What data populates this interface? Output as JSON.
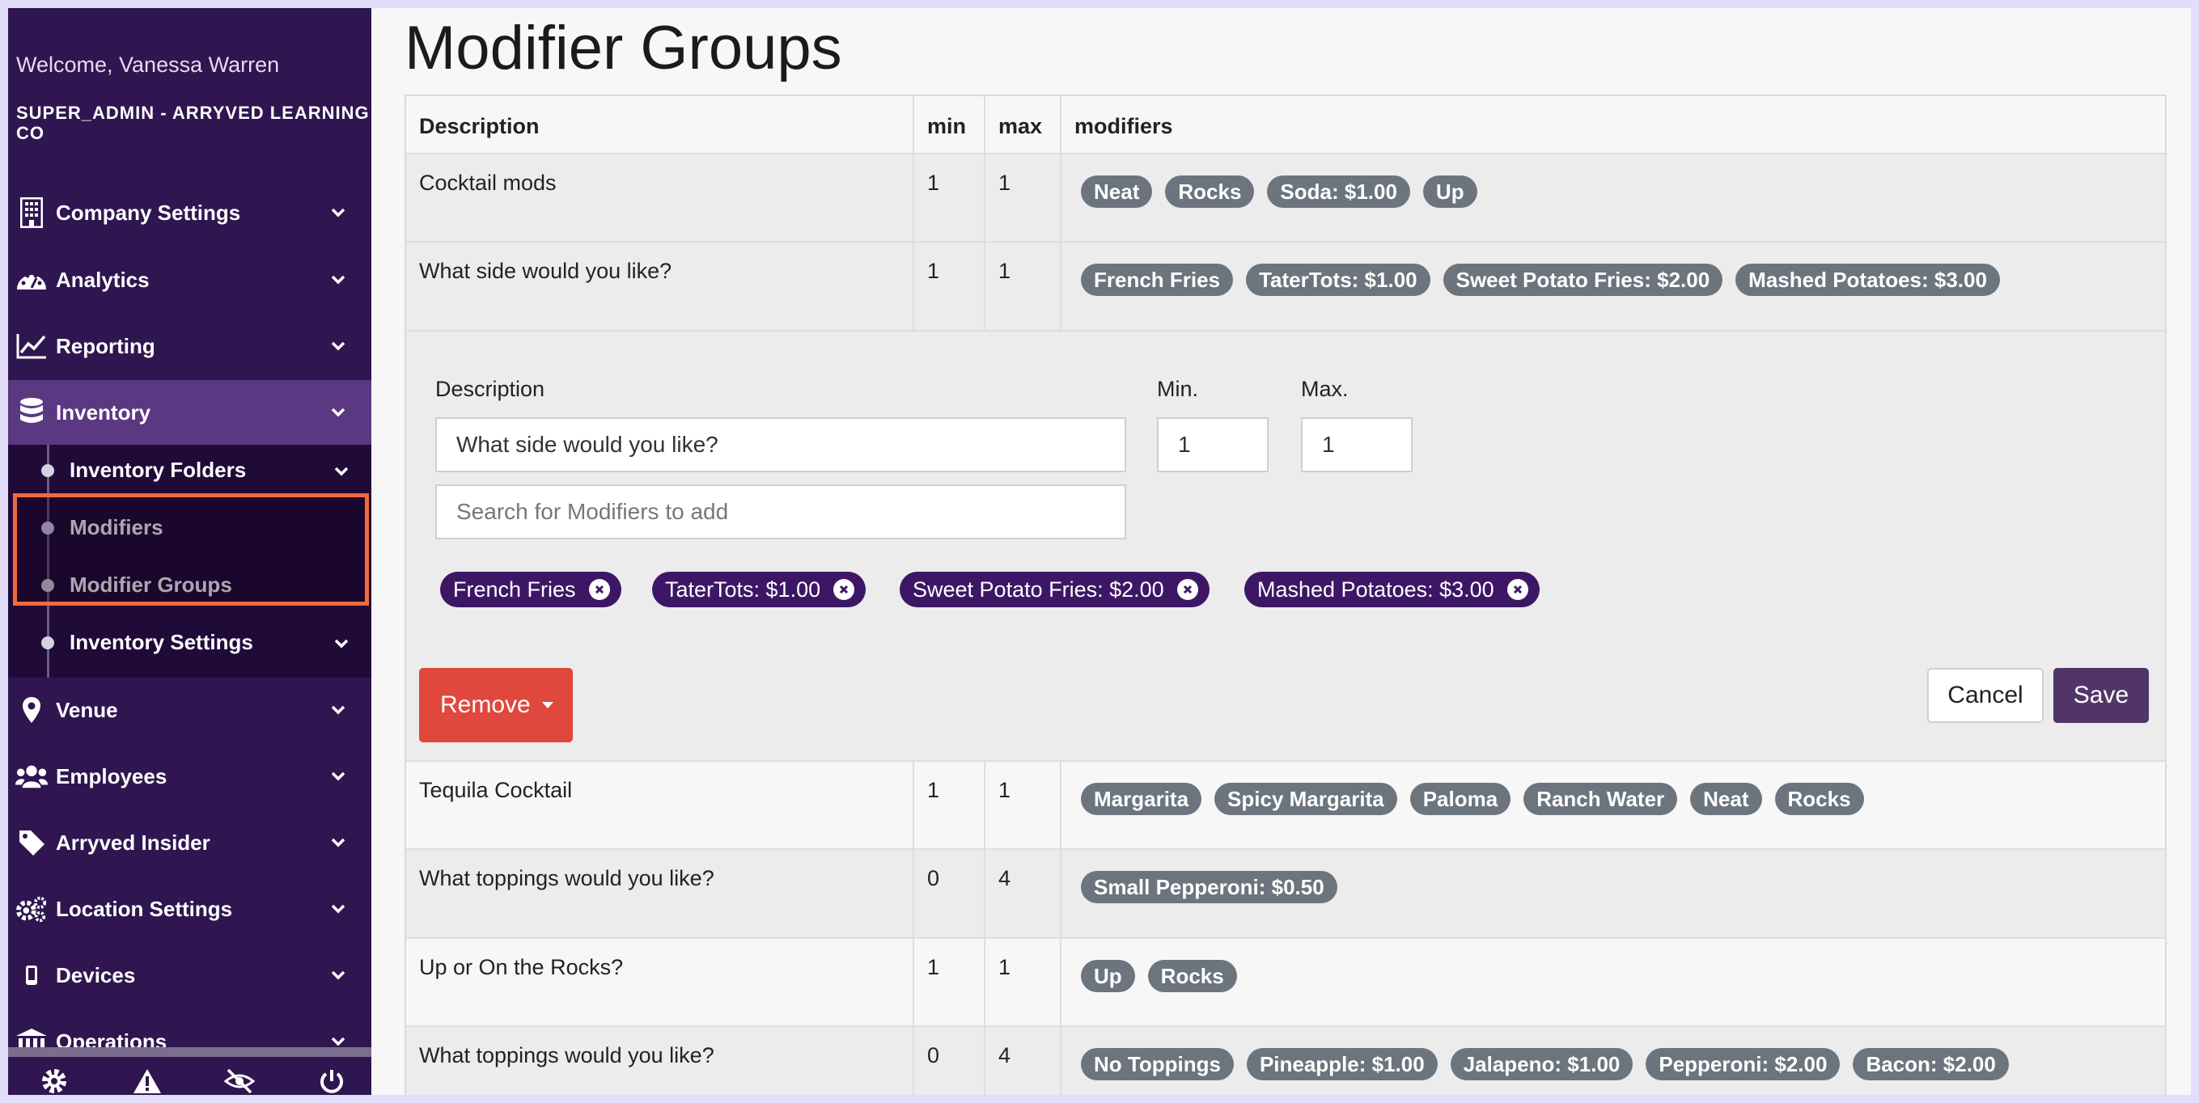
{
  "sidebar": {
    "welcome": "Welcome, Vanessa Warren",
    "role": "SUPER_ADMIN - ARRYVED LEARNING CO",
    "nav": [
      {
        "label": "Company Settings",
        "icon": "building-icon"
      },
      {
        "label": "Analytics",
        "icon": "palette-icon"
      },
      {
        "label": "Reporting",
        "icon": "line-chart-icon"
      },
      {
        "label": "Inventory",
        "icon": "database-icon"
      },
      {
        "label": "Venue",
        "icon": "map-pin-icon"
      },
      {
        "label": "Employees",
        "icon": "users-icon"
      },
      {
        "label": "Arryved Insider",
        "icon": "tag-icon"
      },
      {
        "label": "Location Settings",
        "icon": "cogs-icon"
      },
      {
        "label": "Devices",
        "icon": "mobile-icon"
      },
      {
        "label": "Operations",
        "icon": "bank-icon"
      }
    ],
    "inventory_sub": [
      {
        "label": "Inventory Folders"
      },
      {
        "label": "Modifiers"
      },
      {
        "label": "Modifier Groups"
      },
      {
        "label": "Inventory Settings"
      }
    ],
    "footer_icons": [
      "gear-icon",
      "warning-icon",
      "eye-slash-icon",
      "power-icon"
    ]
  },
  "page": {
    "title": "Modifier Groups"
  },
  "table": {
    "headers": {
      "description": "Description",
      "min": "min",
      "max": "max",
      "modifiers": "modifiers"
    },
    "rows_top": [
      {
        "description": "Cocktail mods",
        "min": "1",
        "max": "1",
        "modifiers": [
          "Neat",
          "Rocks",
          "Soda: $1.00",
          "Up"
        ]
      },
      {
        "description": "What side would you like?",
        "min": "1",
        "max": "1",
        "modifiers": [
          "French Fries",
          "TaterTots: $1.00",
          "Sweet Potato Fries: $2.00",
          "Mashed Potatoes: $3.00"
        ]
      }
    ],
    "rows_bottom": [
      {
        "description": "Tequila Cocktail",
        "min": "1",
        "max": "1",
        "modifiers": [
          "Margarita",
          "Spicy Margarita",
          "Paloma",
          "Ranch Water",
          "Neat",
          "Rocks"
        ]
      },
      {
        "description": "What toppings would you like?",
        "min": "0",
        "max": "4",
        "modifiers": [
          "Small Pepperoni: $0.50"
        ]
      },
      {
        "description": "Up or On the Rocks?",
        "min": "1",
        "max": "1",
        "modifiers": [
          "Up",
          "Rocks"
        ]
      },
      {
        "description": "What toppings would you like?",
        "min": "0",
        "max": "4",
        "modifiers": [
          "No Toppings",
          "Pineapple: $1.00",
          "Jalapeno: $1.00",
          "Pepperoni: $2.00",
          "Bacon: $2.00"
        ]
      }
    ]
  },
  "editor": {
    "description_label": "Description",
    "min_label": "Min.",
    "max_label": "Max.",
    "description_value": "What side would you like?",
    "min_value": "1",
    "max_value": "1",
    "search_placeholder": "Search for Modifiers to add",
    "chips": [
      "French Fries",
      "TaterTots: $1.00",
      "Sweet Potato Fries: $2.00",
      "Mashed Potatoes: $3.00"
    ],
    "remove_label": "Remove",
    "cancel_label": "Cancel",
    "save_label": "Save"
  },
  "colors": {
    "sidebar_bg": "#2f1650",
    "active_nav": "#5a3882",
    "highlight_border": "#f26a3a",
    "badge_gray": "#6c757d",
    "chip_purple": "#3d1766",
    "remove_red": "#e0473d",
    "save_purple": "#513569"
  }
}
